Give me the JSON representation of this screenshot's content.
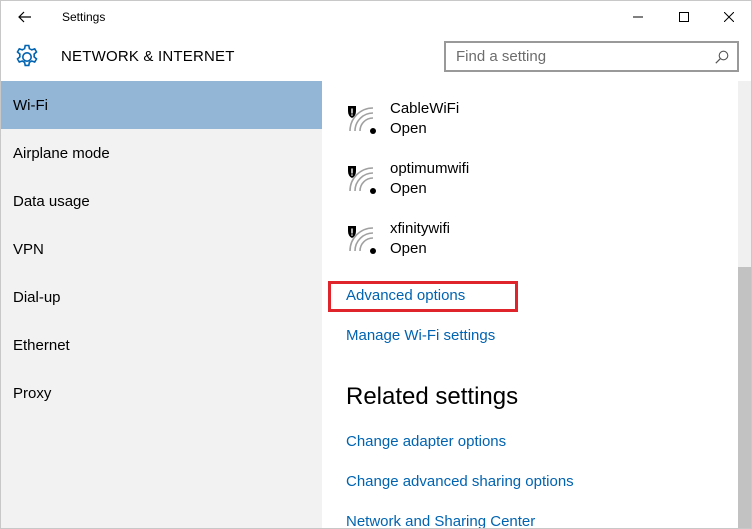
{
  "window": {
    "title": "Settings"
  },
  "header": {
    "title": "NETWORK & INTERNET",
    "search_placeholder": "Find a setting"
  },
  "sidebar": {
    "items": [
      {
        "label": "Wi-Fi",
        "active": true
      },
      {
        "label": "Airplane mode",
        "active": false
      },
      {
        "label": "Data usage",
        "active": false
      },
      {
        "label": "VPN",
        "active": false
      },
      {
        "label": "Dial-up",
        "active": false
      },
      {
        "label": "Ethernet",
        "active": false
      },
      {
        "label": "Proxy",
        "active": false
      }
    ]
  },
  "networks": [
    {
      "name": "CableWiFi",
      "status": "Open"
    },
    {
      "name": "optimumwifi",
      "status": "Open"
    },
    {
      "name": "xfinitywifi",
      "status": "Open"
    }
  ],
  "links": {
    "advanced_options": "Advanced options",
    "manage_wifi": "Manage Wi-Fi settings"
  },
  "related": {
    "title": "Related settings",
    "links": [
      "Change adapter options",
      "Change advanced sharing options",
      "Network and Sharing Center"
    ]
  },
  "colors": {
    "accent_link": "#0063b1",
    "sidebar_active": "#93b6d6",
    "sidebar_bg": "#f2f2f2",
    "highlight": "#e0242b"
  }
}
